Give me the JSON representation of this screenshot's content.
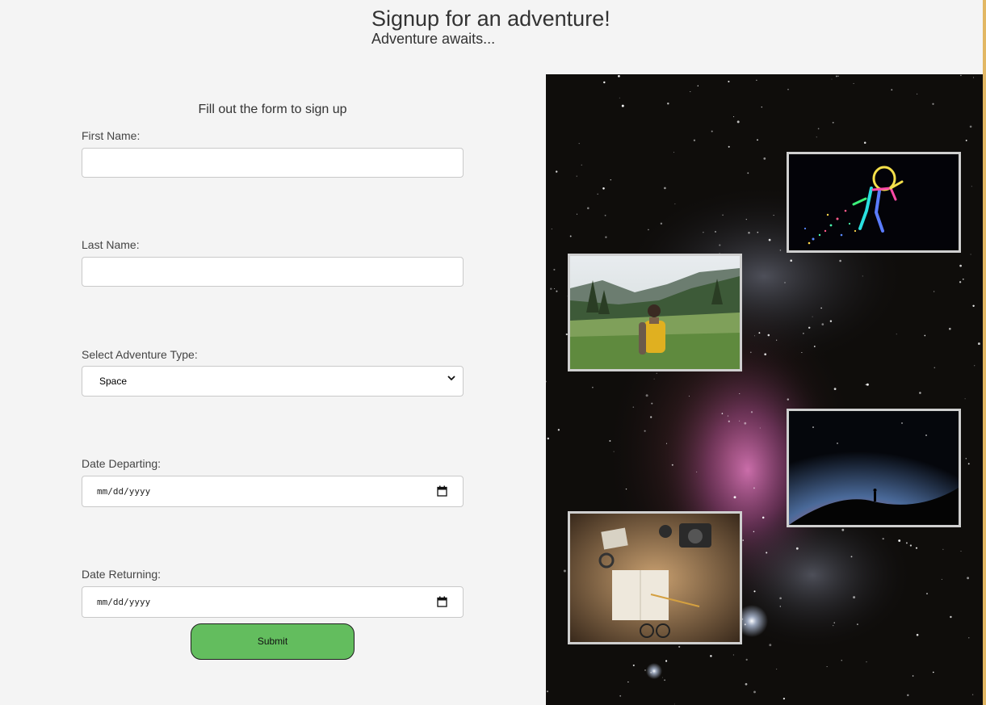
{
  "header": {
    "title": "Signup for an adventure!",
    "subtitle": "Adventure awaits..."
  },
  "form": {
    "title": "Fill out the form to sign up",
    "first_name_label": "First Name:",
    "first_name_value": "",
    "last_name_label": "Last Name:",
    "last_name_value": "",
    "adventure_type_label": "Select Adventure Type:",
    "adventure_type_value": "Space",
    "date_departing_label": "Date Departing:",
    "date_departing_value": "mm/dd/yyyy",
    "date_returning_label": "Date Returning:",
    "date_returning_value": "mm/dd/yyyy",
    "submit_label": "Submit"
  },
  "icons": {
    "select_arrow": "chevron-down-icon",
    "date_picker": "calendar-icon"
  },
  "colors": {
    "page_background": "#f4f4f4",
    "submit_button": "#63bd5e",
    "right_edge_accent": "#e2b763",
    "photo_frame": "#cfcfcf"
  }
}
